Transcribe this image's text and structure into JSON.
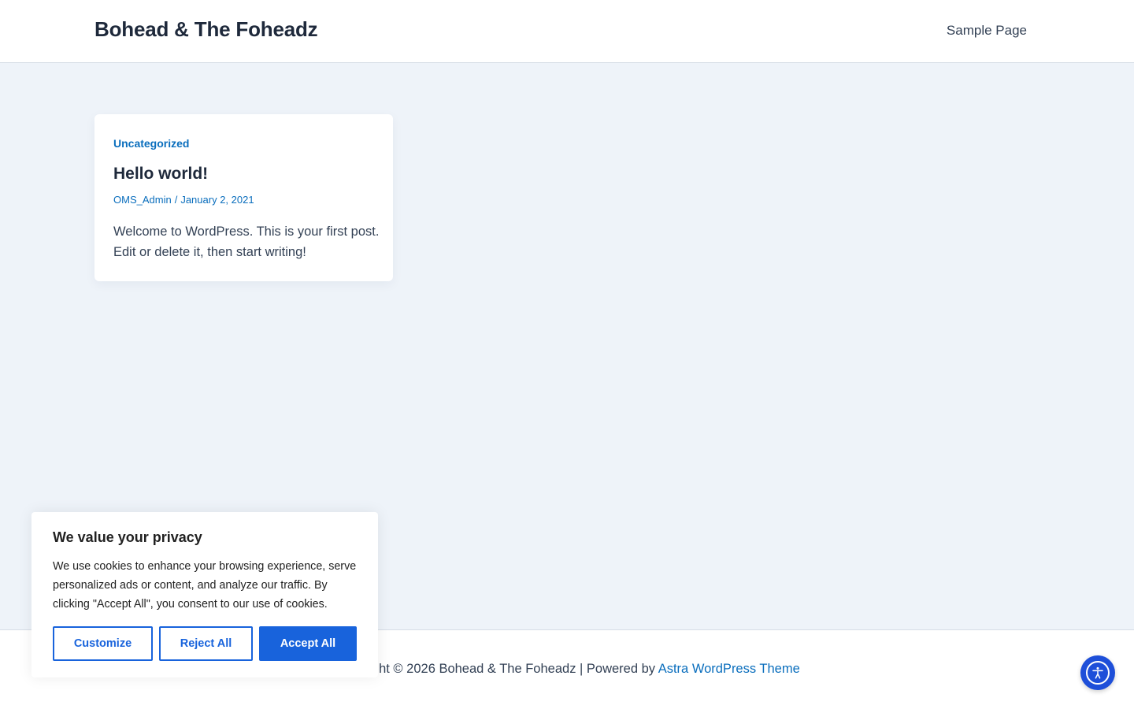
{
  "header": {
    "site_title": "Bohead & The Foheadz",
    "nav": [
      {
        "label": "Sample Page"
      }
    ]
  },
  "post": {
    "category": "Uncategorized",
    "title": "Hello world!",
    "author": "OMS_Admin",
    "separator": "/",
    "date": "January 2, 2021",
    "excerpt": "Welcome to WordPress. This is your first post. Edit or delete it, then start writing!"
  },
  "footer": {
    "copyright": "Copyright © 2026 Bohead & The Foheadz | Powered by ",
    "theme_link": "Astra WordPress Theme"
  },
  "accessibility": {
    "icon": "accessibility-icon",
    "color": "#1e4fd9"
  },
  "cookie_banner": {
    "title": "We value your privacy",
    "text": "We use cookies to enhance your browsing experience, serve personalized ads or content, and analyze our traffic. By clicking \"Accept All\", you consent to our use of cookies.",
    "buttons": {
      "customize": "Customize",
      "reject": "Reject All",
      "accept": "Accept All"
    },
    "accent_color": "#1863dc"
  },
  "colors": {
    "background": "#eef3f9",
    "link": "#0a6ebd",
    "heading": "#1e293b"
  }
}
